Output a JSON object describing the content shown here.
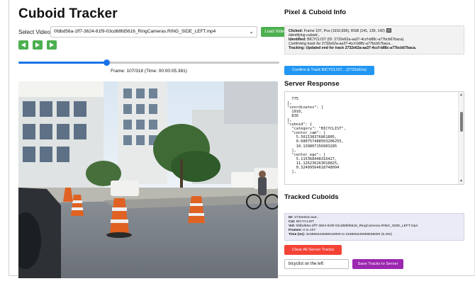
{
  "app": {
    "title": "Cuboid Tracker"
  },
  "video_controls": {
    "select_label": "Select Video:",
    "selected_video": "0fdbd56a-1ff7-3624-81f9-03cd68fd5616_RingCameras.RING_SIDE_LEFT.mp4",
    "load_button": "Load Video",
    "prev_icon": "step-back-icon",
    "play_icon": "play-icon",
    "next_icon": "step-forward-icon",
    "frame_text": "Frame: 107/318 (Time: 00:00:05.381)",
    "current_frame": 107,
    "total_frames": 318,
    "accent_color": "#1a73e8"
  },
  "pixel_info": {
    "heading": "Pixel & Cuboid Info",
    "clicked_label": "Clicked:",
    "clicked_value": "Frame 107, Pos (1910,836), RGB (141, 139, 142)",
    "swatch_color": "#8d8b8e",
    "line2": "Identifying cuboid...",
    "identified_label": "Identified:",
    "identified_value": "BICYCLIST (ID: 2732e62a-aa37-4ccf-b88c-a77bcb67baca).",
    "line4": "Confirming track for 2732e62a-aa37-4ccf-b88c-a77bcb67baca...",
    "tracking_label": "Tracking:",
    "tracking_value": "Updated end for track 2732e62a-aa37-4ccf-b88c-a77bcb67baca.",
    "confirm_button": "Confirm & Track BICYCLIST... (2732e62a)"
  },
  "server_response": {
    "heading": "Server Response",
    "json_text": "  775\n],\n\"coordinates\": [\n  1910,\n  836\n],\n\"cuboid\": {\n  \"category\": \"BICYCLIST\",\n  \"center_cam\": [\n    5.501138376861805,\n    0.680757488503206255,\n    10.139807156903285\n  ],\n  \"center_ego\": [\n    5.115368448316427,\n    11.126236263018825,\n    0.32499564618748094\n  ],"
  },
  "tracked_cuboids": {
    "heading": "Tracked Cuboids",
    "id_label": "ID:",
    "id_value": "2732e62a-aa3...",
    "cat_label": "Cat:",
    "cat_value": "BICYCLIST",
    "vid_label": "Vid:",
    "vid_value": "0fdbd56a-1ff7-3624-81f9-03cd68fd5616_RingCameras.RING_SIDE_LEFT.mp4",
    "frames_label": "Frames:",
    "frames_value": "0 to 107",
    "time_label": "Time (ns):",
    "time_value": "315969443660016000 to 315969449059938000 (5.40s)",
    "clear_button": "Clear All Server Tracks",
    "name_input_value": "bicyclist on the left",
    "save_button": "Save Tracks to Server"
  }
}
